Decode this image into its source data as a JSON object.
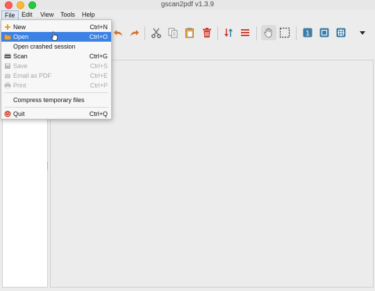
{
  "window": {
    "title": "gscan2pdf v1.3.9"
  },
  "menubar": {
    "items": [
      {
        "label": "File"
      },
      {
        "label": "Edit"
      },
      {
        "label": "View"
      },
      {
        "label": "Tools"
      },
      {
        "label": "Help"
      }
    ]
  },
  "file_menu": {
    "items": [
      {
        "label": "New",
        "shortcut": "Ctrl+N",
        "icon": "plus-icon",
        "enabled": true
      },
      {
        "label": "Open",
        "shortcut": "Ctrl+O",
        "icon": "folder-open-icon",
        "enabled": true,
        "highlighted": true
      },
      {
        "label": "Open crashed session",
        "shortcut": "",
        "icon": "",
        "enabled": true
      },
      {
        "label": "Scan",
        "shortcut": "Ctrl+G",
        "icon": "scanner-icon",
        "enabled": true
      },
      {
        "label": "Save",
        "shortcut": "Ctrl+S",
        "icon": "save-icon",
        "enabled": false
      },
      {
        "label": "Email as PDF",
        "shortcut": "Ctrl+E",
        "icon": "email-icon",
        "enabled": false
      },
      {
        "label": "Print",
        "shortcut": "Ctrl+P",
        "icon": "printer-icon",
        "enabled": false
      },
      {
        "label": "Compress temporary files",
        "shortcut": "",
        "icon": "",
        "enabled": true
      },
      {
        "label": "Quit",
        "shortcut": "Ctrl+Q",
        "icon": "quit-icon",
        "enabled": true
      }
    ]
  },
  "toolbar": {
    "icons": [
      "undo-icon",
      "redo-icon",
      "cut-icon",
      "copy-icon",
      "paste-icon",
      "delete-icon",
      "sort-icon",
      "select-all-icon",
      "hand-icon",
      "marquee-select-icon",
      "zoom-100-icon",
      "zoom-fit-icon",
      "zoom-in-icon",
      "overflow-arrow-icon"
    ]
  },
  "colors": {
    "highlight": "#3b82e4",
    "icon_orange": "#d9702a",
    "icon_red": "#d23a2b",
    "icon_blue": "#3d7ea6"
  }
}
